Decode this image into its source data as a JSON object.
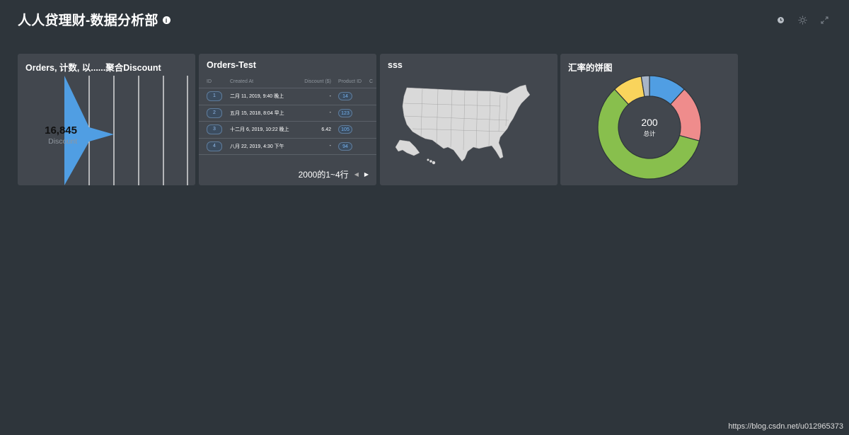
{
  "dashboard": {
    "title": "人人贷理财-数据分析部"
  },
  "toolbar": {
    "icons": [
      "history-icon",
      "sun-icon",
      "fullscreen-icon"
    ]
  },
  "cards": {
    "funnel": {
      "title": "Orders, 计数, 以......聚合Discount",
      "value": "16,845",
      "value_label": "Discount",
      "color": "#509ee3"
    },
    "table": {
      "title": "Orders-Test",
      "columns": [
        "ID",
        "Created At",
        "Discount ($)",
        "Product ID",
        "C"
      ],
      "rows": [
        {
          "id": "1",
          "created_at": "二月 11, 2019, 9:40 晚上",
          "discount": "-",
          "product_id": "14"
        },
        {
          "id": "2",
          "created_at": "五月 15, 2018, 8:04 早上",
          "discount": "-",
          "product_id": "123"
        },
        {
          "id": "3",
          "created_at": "十二月 6, 2019, 10:22 晚上",
          "discount": "6.42",
          "product_id": "105"
        },
        {
          "id": "4",
          "created_at": "八月 22, 2019, 4:30 下午",
          "discount": "-",
          "product_id": "94"
        }
      ],
      "pagination": "2000的1~4行"
    },
    "map": {
      "title": "sss",
      "fill_color": "#d9d9d9"
    },
    "pie": {
      "title": "汇率的饼图",
      "total": "200",
      "total_label": "总计"
    }
  },
  "chart_data": {
    "type": "pie",
    "title": "汇率的饼图",
    "values": [
      23,
      34,
      115,
      18,
      5
    ],
    "colors": [
      "#509ee3",
      "#ef8c8c",
      "#88bf4d",
      "#f9d45c",
      "#a7b5c7"
    ]
  },
  "watermark": "https://blog.csdn.net/u012965373"
}
